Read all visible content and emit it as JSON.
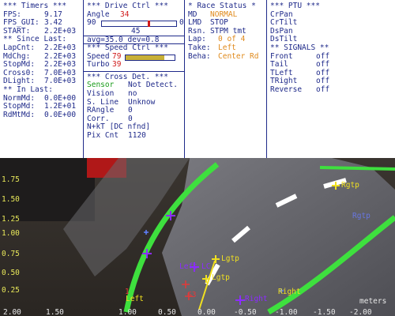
{
  "timers": {
    "header": "*** Timers ***",
    "fps_label": "FPS:",
    "fps_value": "9.17",
    "fps_gui_label": "FPS_GUI:",
    "fps_gui_value": "3.42",
    "start_label": "START:",
    "start_value": "2.2E+03",
    "since_last_header": "** Since Last:",
    "lapcnt_label": "LapCnt:",
    "lapcnt_value": "2.2E+03",
    "mdchg_label": "MdChg:",
    "mdchg_value": "2.2E+03",
    "stopmd_label": "StopMd:",
    "stopmd_value": "2.2E+03",
    "cross0_label": "Cross0:",
    "cross0_value": "7.0E+03",
    "dlight_label": "DLight:",
    "dlight_value": "7.0E+03",
    "in_last_header": "** In Last:",
    "normmd_label": "NormMd:",
    "normmd_value": "0.0E+00",
    "stopmd2_label": "StopMd:",
    "stopmd2_value": "1.2E+01",
    "rdmtmd_label": "RdMtMd:",
    "rdmtmd_value": "0.0E+00"
  },
  "drive": {
    "header": "*** Drive Ctrl ***",
    "angle_label": "Angle",
    "angle_value": "34",
    "angle_left": "90",
    "angle_right": "0",
    "angle_level": 0.62,
    "angle_center": "45",
    "avg_dev": "avg=35.0  dev=0.8",
    "speed_header": "*** Speed Ctrl ***",
    "speed_label": "Speed",
    "speed_value": "79",
    "speed_level": 0.79,
    "turbo_label": "Turbo",
    "turbo_value": "39",
    "cross_header": "*** Cross Det. ***",
    "sensor_label": "Sensor",
    "sensor_value": "Not Detect.",
    "vision_label": "Vision",
    "vision_value": "no",
    "sline_label": "S. Line",
    "sline_value": "Unknow",
    "rangle_label": "RAngle",
    "rangle_value": "0",
    "corr_label": "Corr.",
    "corr_value": "0",
    "nkt": "N+kT [DC nfnd]",
    "pix_label": "Pix Cnt",
    "pix_value": "1120"
  },
  "race": {
    "header": "* Race Status *",
    "md_label": "MD",
    "md_value": "NORMAL",
    "lmd_label": "LMD",
    "lmd_value": "STOP",
    "rsn_label": "Rsn.",
    "rsn_value": "STPM tmt",
    "lap_label": "Lap:",
    "lap_value": "0 of 4",
    "take_label": "Take:",
    "take_value": "Left",
    "beha_label": "Beha:",
    "beha_value": "Center Rd"
  },
  "ptu": {
    "header": "*** PTU ***",
    "items": [
      "CrPan",
      "CrTilt",
      "DsPan",
      "DsTilt"
    ],
    "signals_header": "** SIGNALS **",
    "signals": [
      {
        "name": "Front",
        "state": "off"
      },
      {
        "name": "Tail",
        "state": "off"
      },
      {
        "name": "TLeft",
        "state": "off"
      },
      {
        "name": "TRight",
        "state": "off"
      },
      {
        "name": "Reverse",
        "state": "off"
      }
    ]
  },
  "view": {
    "y_ticks": [
      "1.75",
      "1.50",
      "1.25",
      "1.00",
      "0.75",
      "0.50",
      "0.25"
    ],
    "x_ticks": [
      "2.00",
      "1.50",
      "1.00",
      "0.50",
      "0.00",
      "-0.50",
      "-1.00",
      "-1.50",
      "-2.00"
    ],
    "x_unit": "meters",
    "labels": {
      "rgtp": "Rgtp",
      "rgtp_faint": "Rgtp",
      "lgtp1": "Lgtp",
      "lgtp2": "Lgtp",
      "left": "Left",
      "right": "Right",
      "cross_right": "Right",
      "cross_left": "Left",
      "g3": "G3",
      "lc": "LC",
      "n1": "1"
    }
  },
  "colors": {
    "panel_text": "#1f2a8a",
    "alert_red": "#d01a1a",
    "warning_orange": "#e08a1c",
    "sensor_green": "#1a9c1a",
    "lane_green": "#3ee03e",
    "marker_yellow": "#f0e020",
    "marker_purple": "#8c2cff"
  }
}
